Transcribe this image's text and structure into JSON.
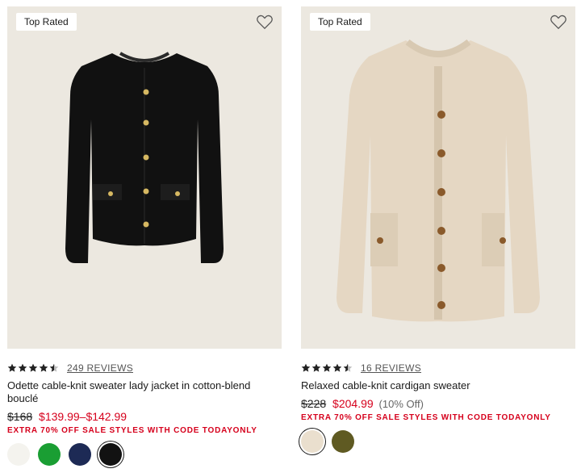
{
  "products": [
    {
      "badge": "Top Rated",
      "rating": 4.5,
      "reviews_label": "249 REVIEWS",
      "title": "Odette cable-knit sweater lady jacket in cotton-blend bouclé",
      "original_price": "$168",
      "sale_price": "$139.99–$142.99",
      "discount": "",
      "promo": "EXTRA 70% OFF SALE STYLES WITH CODE TODAYONLY",
      "swatches": [
        {
          "color": "#f4f3ee",
          "selected": false
        },
        {
          "color": "#1a9e33",
          "selected": false
        },
        {
          "color": "#1d2a55",
          "selected": false
        },
        {
          "color": "#121212",
          "selected": true
        }
      ]
    },
    {
      "badge": "Top Rated",
      "rating": 4.5,
      "reviews_label": "16 REVIEWS",
      "title": "Relaxed cable-knit cardigan sweater",
      "original_price": "$228",
      "sale_price": "$204.99",
      "discount": "(10% Off)",
      "promo": "EXTRA 70% OFF SALE STYLES WITH CODE TODAYONLY",
      "swatches": [
        {
          "color": "#eadfce",
          "selected": true
        },
        {
          "color": "#5f5a22",
          "selected": false
        }
      ]
    }
  ]
}
